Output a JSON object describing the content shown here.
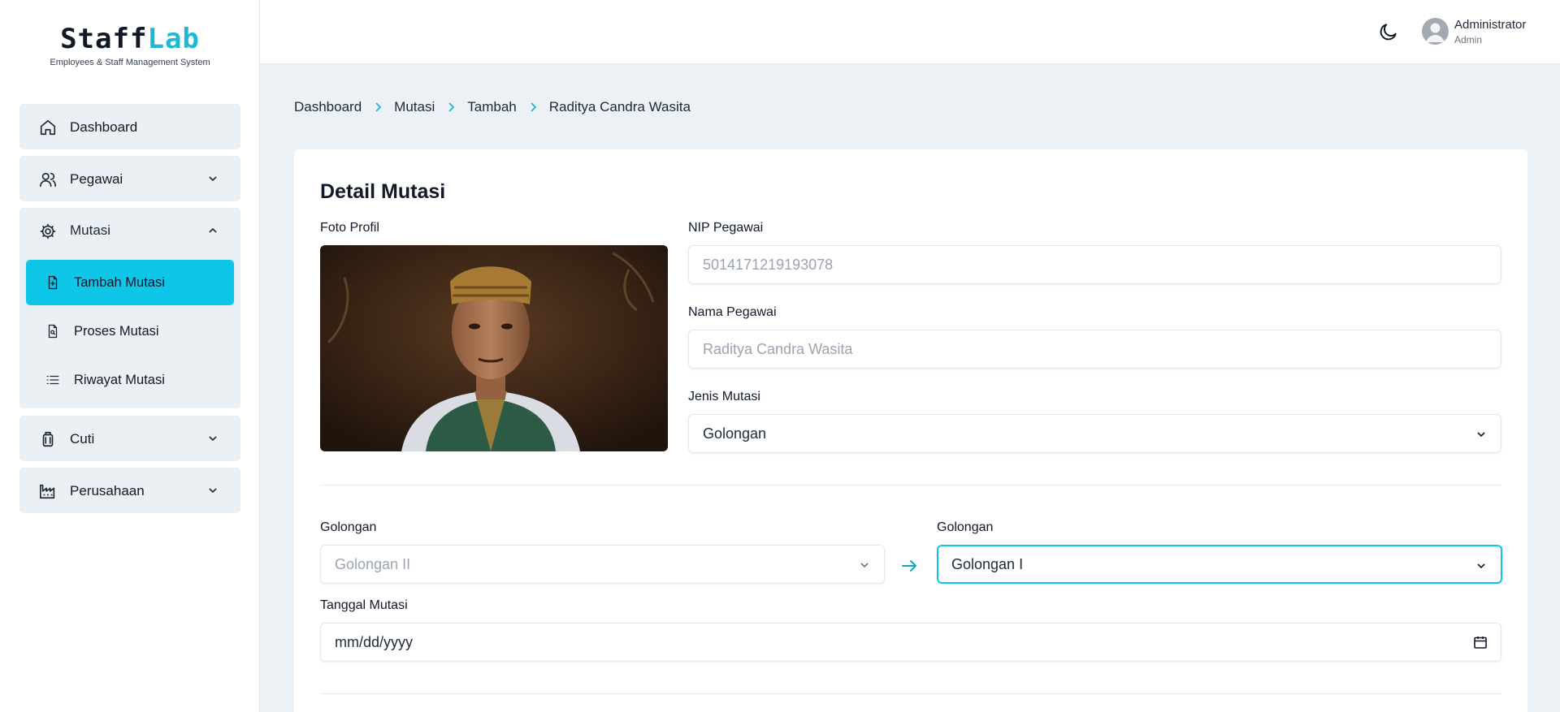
{
  "brand": {
    "name_part1": "Staff",
    "name_part2": "Lab",
    "tagline": "Employees & Staff Management System",
    "accent_color": "#1eb7d6"
  },
  "sidebar": {
    "dashboard": {
      "label": "Dashboard",
      "icon": "home-icon"
    },
    "pegawai": {
      "label": "Pegawai",
      "icon": "users-icon"
    },
    "mutasi": {
      "label": "Mutasi",
      "icon": "gear-icon",
      "expanded": true,
      "items": [
        {
          "label": "Tambah Mutasi",
          "icon": "file-plus-icon",
          "active": true
        },
        {
          "label": "Proses Mutasi",
          "icon": "file-search-icon",
          "active": false
        },
        {
          "label": "Riwayat Mutasi",
          "icon": "list-icon",
          "active": false
        }
      ]
    },
    "cuti": {
      "label": "Cuti",
      "icon": "luggage-icon"
    },
    "perusahaan": {
      "label": "Perusahaan",
      "icon": "factory-icon"
    },
    "active_color": "#0ec6e8"
  },
  "header": {
    "user_name": "Administrator",
    "user_role": "Admin",
    "theme_icon": "moon-icon"
  },
  "breadcrumb": [
    "Dashboard",
    "Mutasi",
    "Tambah",
    "Raditya Candra Wasita"
  ],
  "form": {
    "title": "Detail Mutasi",
    "photo_label": "Foto Profil",
    "nip_label": "NIP Pegawai",
    "nip_value": "5014171219193078",
    "nama_label": "Nama Pegawai",
    "nama_value": "Raditya Candra Wasita",
    "jenis_label": "Jenis Mutasi",
    "jenis_value": "Golongan",
    "golongan_from_label": "Golongan",
    "golongan_from_value": "Golongan II",
    "golongan_to_label": "Golongan",
    "golongan_to_value": "Golongan I",
    "tanggal_label": "Tanggal Mutasi",
    "tanggal_placeholder": "mm/dd/yyyy"
  }
}
